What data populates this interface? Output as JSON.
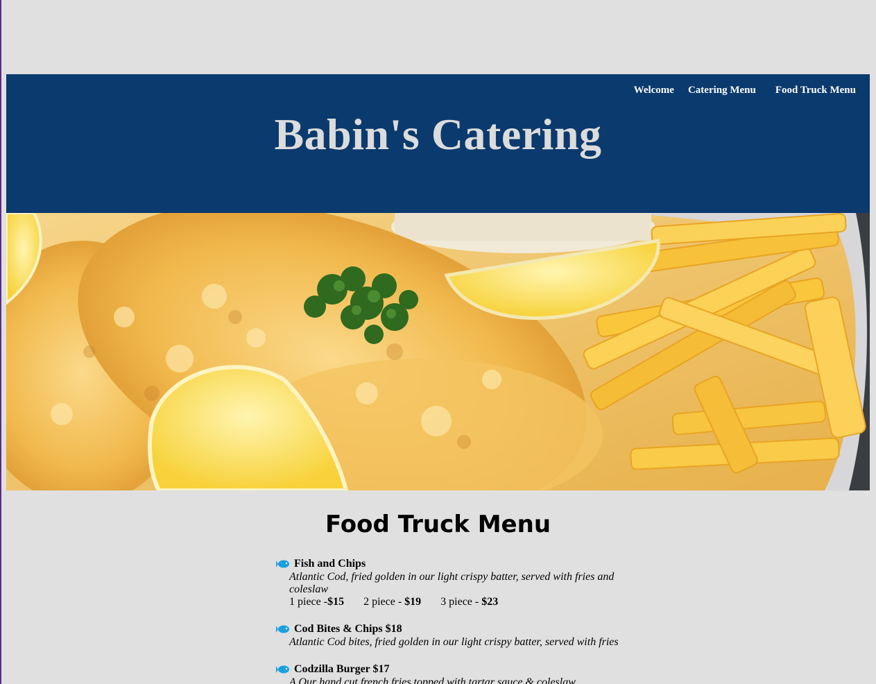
{
  "header": {
    "title": "Babin's Catering",
    "nav": [
      "Welcome",
      "Catering Menu",
      "Food Truck Menu"
    ]
  },
  "hero": {
    "image": "fish-and-chips-photo"
  },
  "menu": {
    "heading": "Food Truck Menu",
    "items": [
      {
        "name": "Fish and Chips",
        "description": "Atlantic Cod, fried golden in our light crispy batter, served with fries and coleslaw",
        "prices": [
          {
            "label": "1 piece -",
            "amount": "$15"
          },
          {
            "label": "2 piece - ",
            "amount": "$19"
          },
          {
            "label": "3 piece - ",
            "amount": "$23"
          }
        ]
      },
      {
        "name": "Cod Bites & Chips $18",
        "description": "Atlantic Cod bites, fried golden in our light crispy batter, served with fries"
      },
      {
        "name": "Codzilla Burger $17",
        "description": "A Our hand cut french fries topped with tartar sauce & coleslaw"
      }
    ]
  },
  "colors": {
    "page_bg": "#e0e0e0",
    "header_bg": "#0b3a6e",
    "title_text": "#dcdcdc",
    "icon": "#1a9fe0"
  }
}
